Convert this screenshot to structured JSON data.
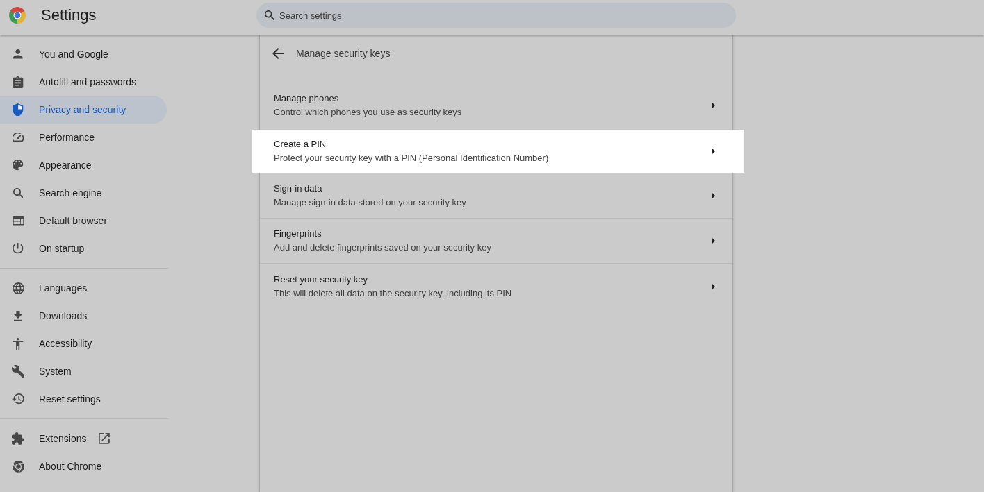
{
  "header": {
    "title": "Settings",
    "search": {
      "placeholder": "Search settings"
    }
  },
  "sidebar": {
    "groups": [
      {
        "items": [
          {
            "label": "You and Google",
            "selected": false,
            "external": false
          },
          {
            "label": "Autofill and passwords",
            "selected": false,
            "external": false
          },
          {
            "label": "Privacy and security",
            "selected": true,
            "external": false
          },
          {
            "label": "Performance",
            "selected": false,
            "external": false
          },
          {
            "label": "Appearance",
            "selected": false,
            "external": false
          },
          {
            "label": "Search engine",
            "selected": false,
            "external": false
          },
          {
            "label": "Default browser",
            "selected": false,
            "external": false
          },
          {
            "label": "On startup",
            "selected": false,
            "external": false
          }
        ]
      },
      {
        "items": [
          {
            "label": "Languages",
            "selected": false,
            "external": false
          },
          {
            "label": "Downloads",
            "selected": false,
            "external": false
          },
          {
            "label": "Accessibility",
            "selected": false,
            "external": false
          },
          {
            "label": "System",
            "selected": false,
            "external": false
          },
          {
            "label": "Reset settings",
            "selected": false,
            "external": false
          }
        ]
      },
      {
        "items": [
          {
            "label": "Extensions",
            "selected": false,
            "external": true
          },
          {
            "label": "About Chrome",
            "selected": false,
            "external": false
          }
        ]
      }
    ]
  },
  "page": {
    "title": "Manage security keys",
    "rows": [
      {
        "title": "Manage phones",
        "description": "Control which phones you use as security keys",
        "highlighted": false
      },
      {
        "title": "Create a PIN",
        "description": "Protect your security key with a PIN (Personal Identification Number)",
        "highlighted": true
      },
      {
        "title": "Sign-in data",
        "description": "Manage sign-in data stored on your security key",
        "highlighted": false
      },
      {
        "title": "Fingerprints",
        "description": "Add and delete fingerprints saved on your security key",
        "highlighted": false
      },
      {
        "title": "Reset your security key",
        "description": "This will delete all data on the security key, including its PIN",
        "highlighted": false
      }
    ]
  }
}
